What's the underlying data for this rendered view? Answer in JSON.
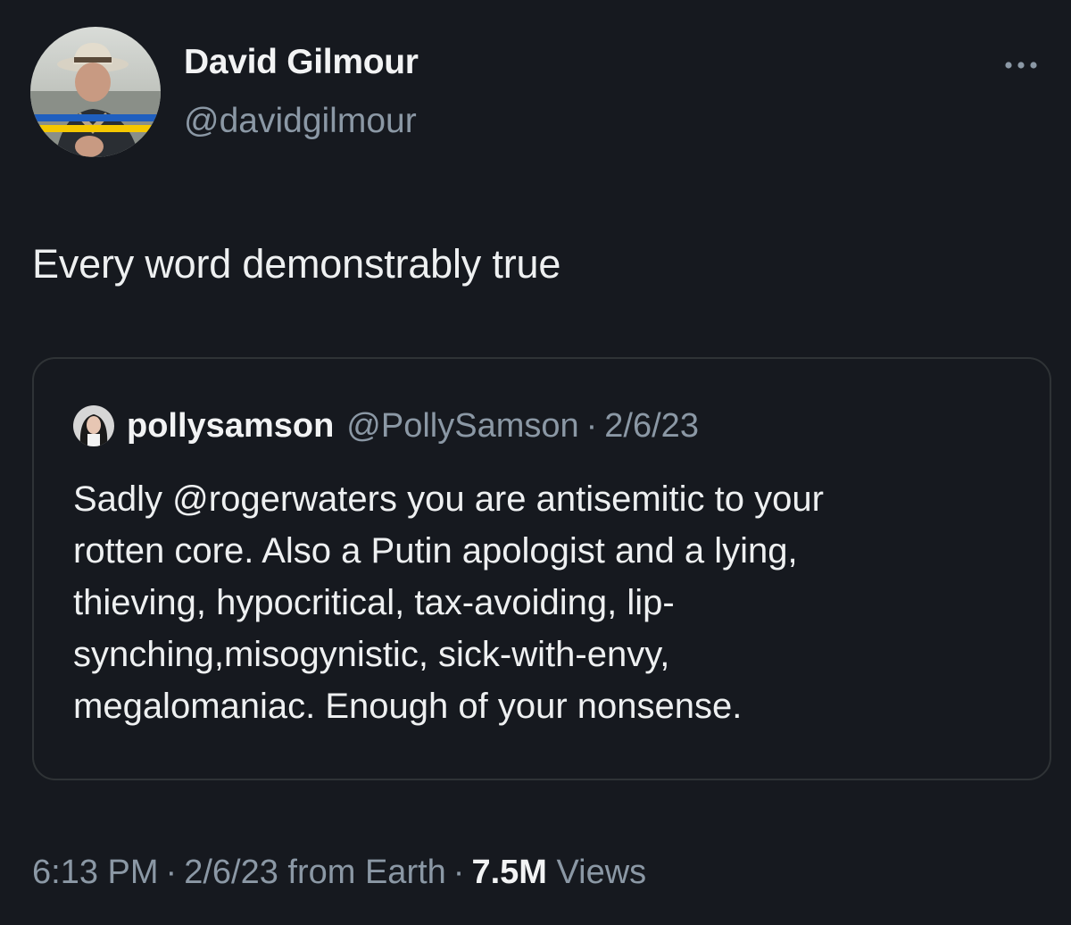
{
  "author": {
    "display_name": "David Gilmour",
    "handle": "@davidgilmour",
    "avatar_icon": "user-avatar-photo"
  },
  "tweet": {
    "text": "Every word demonstrably true"
  },
  "quoted_tweet": {
    "display_name": "pollysamson",
    "handle": "@PollySamson",
    "separator": "·",
    "date": "2/6/23",
    "text_lines": [
      "Sadly @rogerwaters you are antisemitic to your",
      "rotten core. Also a Putin apologist and a lying,",
      "thieving, hypocritical, tax-avoiding, lip-",
      "synching,misogynistic, sick-with-envy,",
      "megalomaniac. Enough of your nonsense."
    ]
  },
  "meta": {
    "time": "6:13 PM",
    "separator": "·",
    "date": "2/6/23",
    "source": "from Earth",
    "views_count": "7.5M",
    "views_label": "Views"
  },
  "icons": {
    "more": "more-horizontal-icon"
  },
  "colors": {
    "background": "#16191f",
    "primary_text": "#e7e9ea",
    "secondary_text": "#8b98a5",
    "border": "#2f3336",
    "flag_blue": "#1f5fbf",
    "flag_yellow": "#f5c800"
  }
}
